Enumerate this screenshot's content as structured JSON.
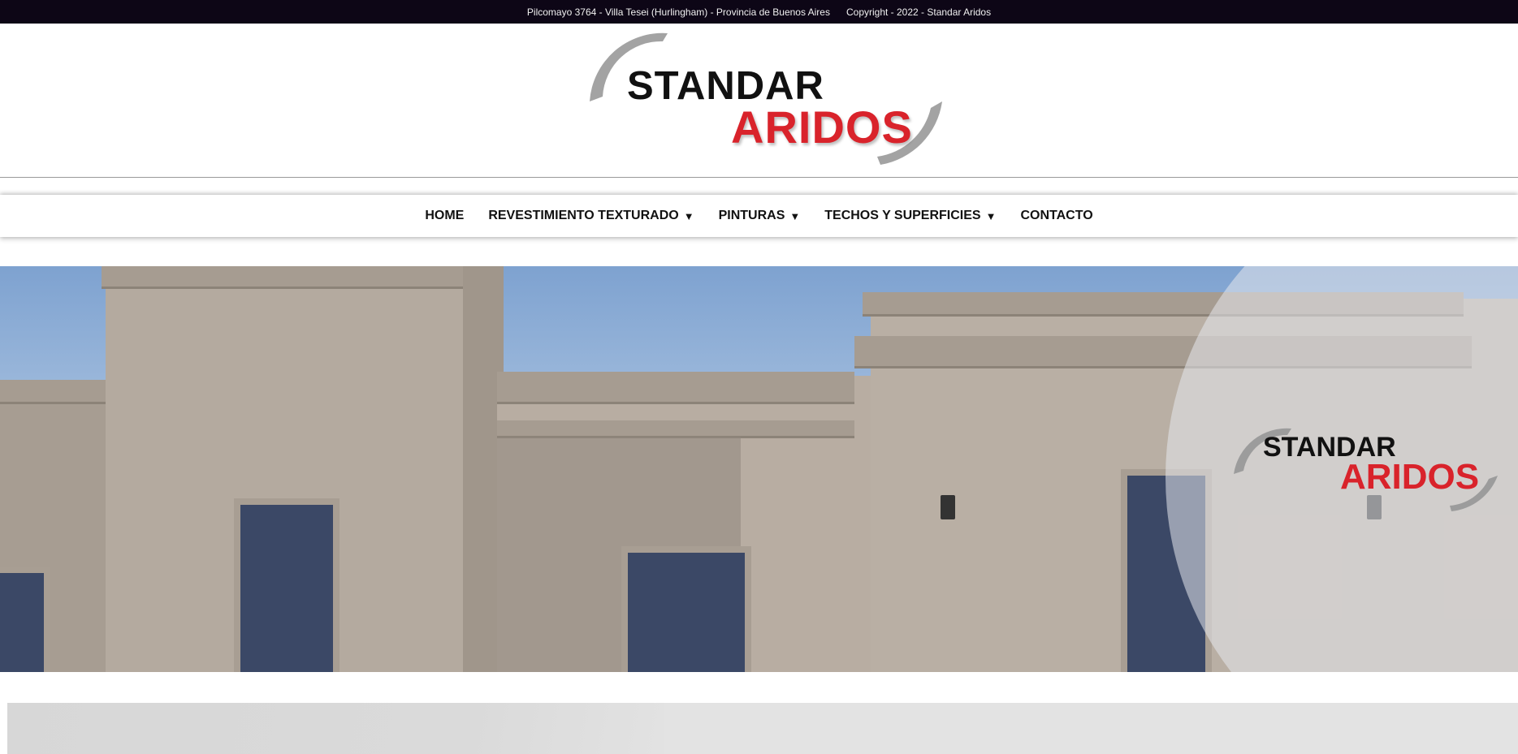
{
  "topbar": {
    "address": "Pilcomayo 3764 - Villa Tesei (Hurlingham) - Provincia de Buenos Aires",
    "copyright": "Copyright - 2022 - Standar Aridos"
  },
  "logo": {
    "line1": "STANDAR",
    "line2": "ARIDOS"
  },
  "nav": {
    "items": [
      {
        "label": "HOME",
        "has_dropdown": false
      },
      {
        "label": "REVESTIMIENTO TEXTURADO",
        "has_dropdown": true
      },
      {
        "label": "PINTURAS",
        "has_dropdown": true
      },
      {
        "label": "TECHOS Y SUPERFICIES",
        "has_dropdown": true
      },
      {
        "label": "CONTACTO",
        "has_dropdown": false
      }
    ],
    "dropdown_glyph": "▼"
  },
  "hero": {
    "logo_line1": "STANDAR",
    "logo_line2": "ARIDOS"
  },
  "colors": {
    "topbar_bg": "#0d0616",
    "brand_red": "#d9232b",
    "brand_gray": "#9e9e9e"
  }
}
